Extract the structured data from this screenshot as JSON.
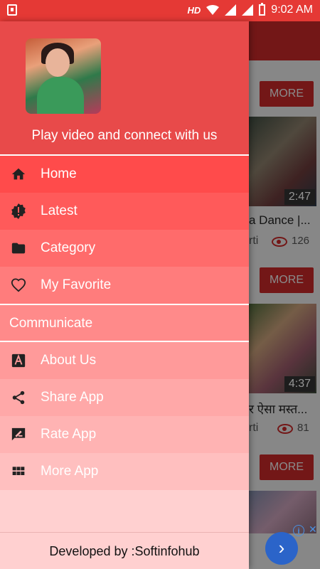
{
  "status_bar": {
    "network": "HD",
    "time": "9:02 AM"
  },
  "drawer": {
    "tagline": "Play video and connect with us",
    "items": [
      {
        "label": "Home",
        "icon": "home-icon"
      },
      {
        "label": "Latest",
        "icon": "badge-alert-icon"
      },
      {
        "label": "Category",
        "icon": "folder-icon"
      },
      {
        "label": "My Favorite",
        "icon": "heart-icon"
      }
    ],
    "section": "Communicate",
    "more_items": [
      {
        "label": "About Us",
        "icon": "about-icon"
      },
      {
        "label": "Share App",
        "icon": "share-icon"
      },
      {
        "label": "Rate App",
        "icon": "rate-icon"
      },
      {
        "label": "More App",
        "icon": "grid-icon"
      }
    ],
    "footer": "Developed by :Softinfohub"
  },
  "background": {
    "more_label": "MORE",
    "cards": [
      {
        "duration": "2:47",
        "title": "a Dance |...",
        "channel": "rti",
        "views": "126"
      },
      {
        "duration": "4:37",
        "title": "र ऐसा मस्त...",
        "channel": "rti",
        "views": "81"
      }
    ]
  },
  "colors": {
    "status_bar": "#e53935",
    "header": "#e84a4a",
    "accent": "#c62828"
  }
}
